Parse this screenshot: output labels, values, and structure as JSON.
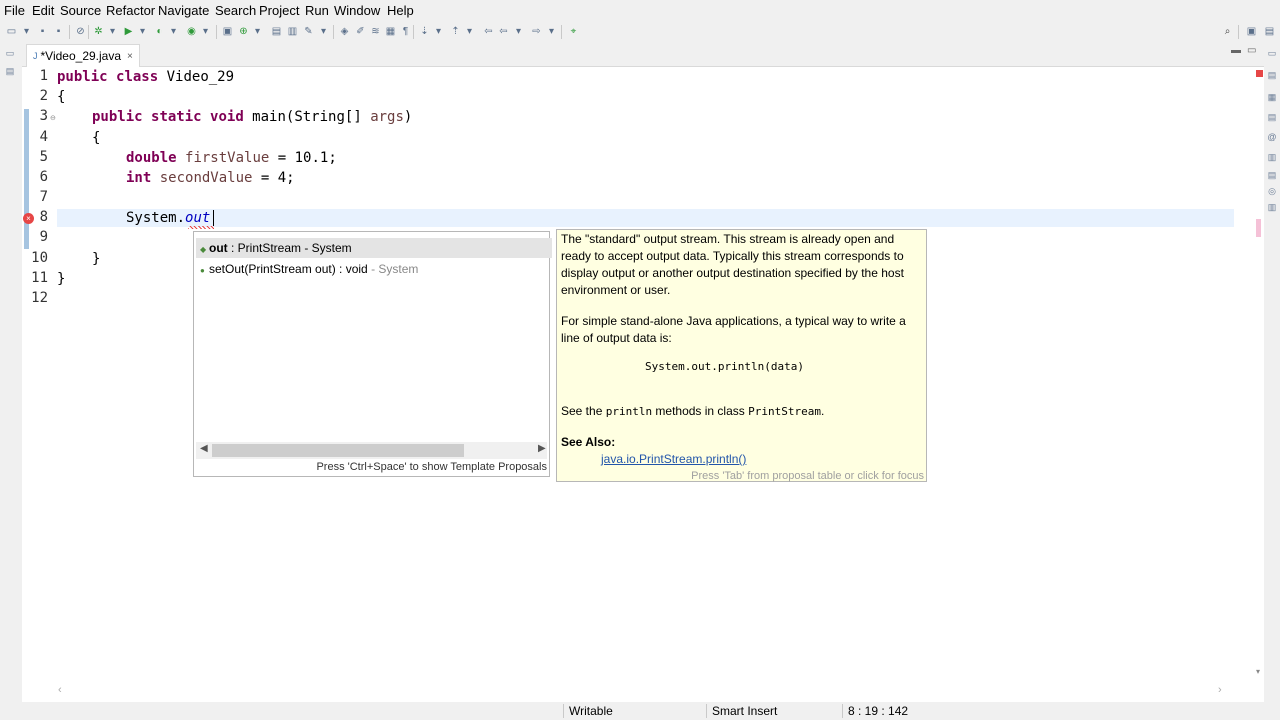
{
  "menu": [
    "File",
    "Edit",
    "Source",
    "Refactor",
    "Navigate",
    "Search",
    "Project",
    "Run",
    "Window",
    "Help"
  ],
  "tab": {
    "title": "*Video_29.java",
    "close_glyph": "×"
  },
  "editor": {
    "line_numbers": [
      "1",
      "2",
      "3",
      "4",
      "5",
      "6",
      "7",
      "8",
      "9",
      "10",
      "11",
      "12"
    ],
    "lines": {
      "l1_kw1": "public",
      "l1_kw2": "class",
      "l1_name": " Video_29",
      "l2": "{",
      "l3_kw1": "public",
      "l3_kw2": "static",
      "l3_kw3": "void",
      "l3_rest": " main(String[] ",
      "l3_arg": "args",
      "l3_end": ")",
      "l4": "{",
      "l5_kw": "double",
      "l5_var": "firstValue",
      "l5_rest": " = 10.1;",
      "l6_kw": "int",
      "l6_var": "secondValue",
      "l6_rest": " = 4;",
      "l8_cls": "System.",
      "l8_fld": "out",
      "l10": "}",
      "l11": "}"
    }
  },
  "assist": {
    "proposals": [
      {
        "name": "out",
        "sig": " : PrintStream - System",
        "qual": ""
      },
      {
        "name": "setOut",
        "sig": "(PrintStream out) : void",
        "qual": " - System"
      }
    ],
    "footer": "Press 'Ctrl+Space' to show Template Proposals"
  },
  "javadoc": {
    "p1": "The \"standard\" output stream. This stream is already open and ready to accept output data. Typically this stream corresponds to display output or another output destination specified by the host environment or user.",
    "p2": "For simple stand-alone Java applications, a typical way to write a line of output data is:",
    "code": "System.out.println(data)",
    "p3_a": "See the ",
    "p3_b": "println",
    "p3_c": " methods in class ",
    "p3_d": "PrintStream",
    "p3_e": ".",
    "see_also": "See Also:",
    "link": "java.io.PrintStream.println()",
    "footer": "Press 'Tab' from proposal table or click for focus"
  },
  "status": {
    "writable": "Writable",
    "insert_mode": "Smart Insert",
    "position": "8 : 19 : 142"
  },
  "colors": {
    "keyword": "#7f0055",
    "field": "#0000c0",
    "local_var": "#6a3e3e",
    "hover_bg": "#ffffe1",
    "current_line": "#e8f2fe"
  }
}
